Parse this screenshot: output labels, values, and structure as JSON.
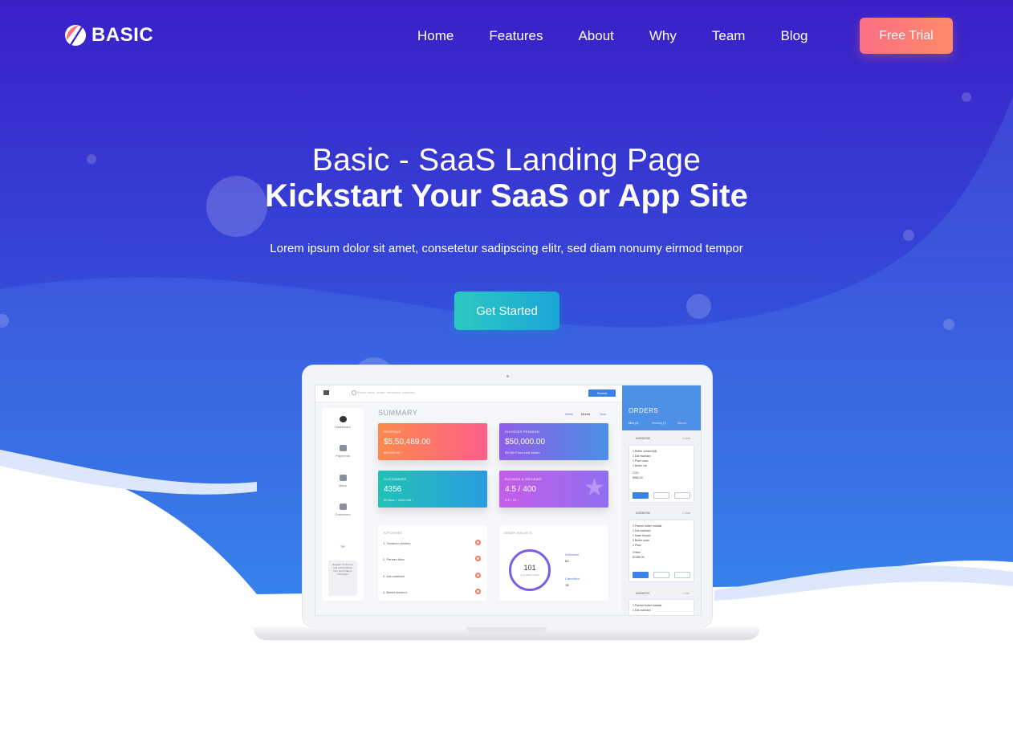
{
  "brand": {
    "name": "BASIC",
    "logo_icon": "leaf-logo-icon"
  },
  "nav": {
    "items": [
      "Home",
      "Features",
      "About",
      "Why",
      "Team",
      "Blog"
    ],
    "trial_label": "Free Trial"
  },
  "hero": {
    "title_line1": "Basic - SaaS Landing Page",
    "title_line2": "Kickstart Your SaaS or App Site",
    "subtitle": "Lorem ipsum dolor sit amet, consetetur sadipscing elitr, sed diam nonumy eirmod tempor",
    "cta_label": "Get Started"
  },
  "colors": {
    "hero_top": "#3a1fc7",
    "hero_bottom": "#2f7fe8",
    "trial_button": "#fd7a76",
    "start_button": "#22b8cc"
  },
  "dashboard": {
    "search_placeholder": "Search orders, drivers, restaurants, customers",
    "search_button": "Search",
    "user_name": "RIO RENERT",
    "sidebar": [
      "Dashboard",
      "Payments",
      "Menu",
      "Customers"
    ],
    "tip_title": "TIP",
    "tip_text": "Register for Brunch and selling dishes from just Friday to Thursdays",
    "summary_title": "SUMMARY",
    "periods": [
      "Week",
      "Month",
      "Year"
    ],
    "cards": [
      {
        "label": "REVENUE",
        "value": "$5,50,489.00",
        "sub": "$80,000.00 ↑"
      },
      {
        "label": "INVOICES PENDING",
        "value": "$50,000.00",
        "sub": "$3,000 From Last Month"
      },
      {
        "label": "CUSTOMERS",
        "value": "4356",
        "sub": "50 New ↑     1000 Old ↑"
      },
      {
        "label": "RATINGS & REVIEWS",
        "value": "4.5 / 400",
        "sub": "3.9 ↑      22 ↑"
      }
    ],
    "top_dishes_title": "TOP DISHES",
    "top_dishes": [
      "1. Tandoori chicken",
      "2. Paneer tikka",
      "3. Dal makhani",
      "4. Butter chicken"
    ],
    "order_insights_title": "ORDER INSIGHTS",
    "gauge_value": "101",
    "gauge_label": "Avg. Daily Orders",
    "delivered_label": "Delivered",
    "delivered_value": "83",
    "cancelled_label": "Cancelled",
    "cancelled_value": "18",
    "orders_title": "ORDERS",
    "order_tabs": [
      "New (3)",
      "Pending (7)",
      "Served"
    ],
    "orders": [
      {
        "id": "#10284786",
        "time": "4 mins",
        "lines": [
          "1 Butter chicken(M)",
          "1 Dal makhani",
          "1 Plain naan",
          "1 Butter roti"
        ],
        "payment": "COD",
        "amount": "$586.00"
      },
      {
        "id": "#10284786",
        "time": "2 mins",
        "lines": [
          "2 Paneer butter masala",
          "1 Dal makhani",
          "1 Naan biryani",
          "3 Butter naan",
          "1 Plain"
        ],
        "payment": "Online",
        "amount": "$1386.00"
      },
      {
        "id": "#10284787",
        "time": "1 min",
        "lines": [
          "2 Paneer butter masala",
          "1 Dal makhani"
        ],
        "payment": "",
        "amount": ""
      }
    ]
  }
}
